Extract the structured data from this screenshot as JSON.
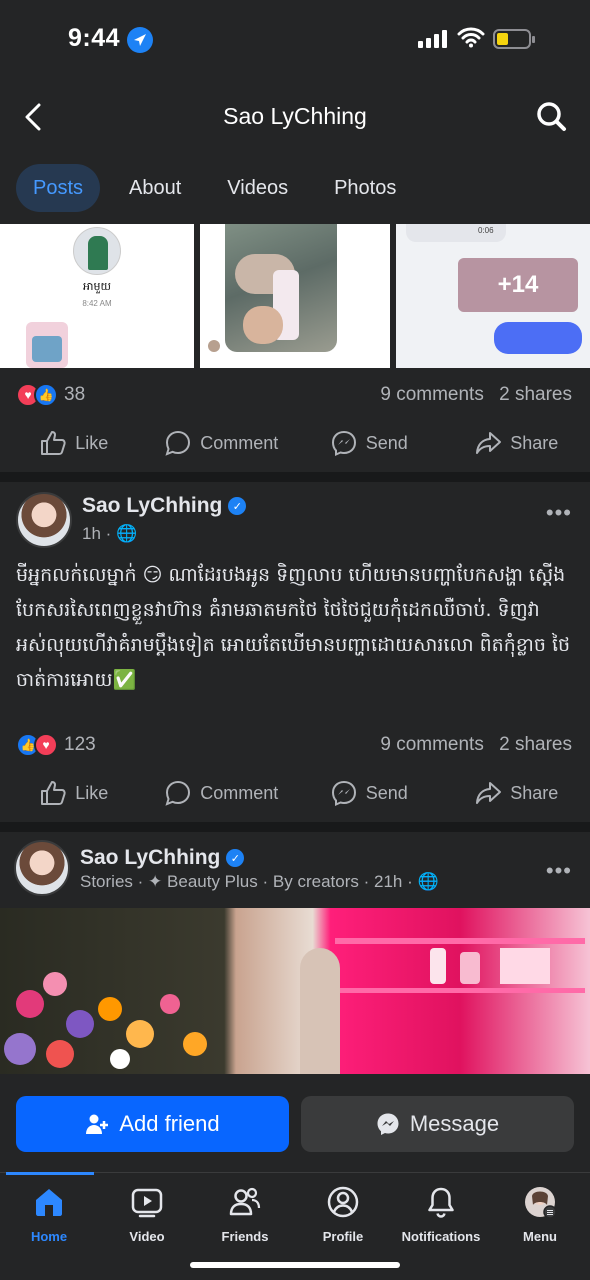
{
  "status_bar": {
    "time": "9:44"
  },
  "topbar": {
    "title": "Sao LyChhing",
    "back_icon": "chevron-left-icon",
    "search_icon": "search-icon"
  },
  "tabs": [
    {
      "label": "Posts",
      "active": true
    },
    {
      "label": "About",
      "active": false
    },
    {
      "label": "Videos",
      "active": false
    },
    {
      "label": "Photos",
      "active": false
    }
  ],
  "thumbs": {
    "t1_caption": "អាមួយ",
    "t1_time": "8:42 AM",
    "t3_more": "+14",
    "t3_time": "0:06"
  },
  "post1": {
    "reaction_count": "38",
    "comments": "9 comments",
    "shares": "2 shares"
  },
  "actions": {
    "like": "Like",
    "comment": "Comment",
    "send": "Send",
    "share": "Share"
  },
  "post2": {
    "author": "Sao LyChhing",
    "time": "1h",
    "text": "មីអ្នកលក់លេម្នាក់ 😏 ណាដែរបងអូន ទិញលាប ហើយមានបញ្ហាបែកសង្ហា ស្តើងបែកសរសៃពេញខ្លួនវាហ៊ាន គំរាមឆាតមកថៃ ថៃថៃជួយកុំដេកឈឺចាប់. ទិញវាអស់លុយហើវាគំរាមប្ដឹងទៀត អោយតែឃើមានបញ្ហាដោយសារលោ ពិតកុំខ្លាច ថៃចាត់ការអោយ✅",
    "reaction_count": "123",
    "comments": "9 comments",
    "shares": "2 shares"
  },
  "post3": {
    "author": "Sao LyChhing",
    "meta_stories": "Stories",
    "meta_effect": "Beauty Plus",
    "meta_by": "By creators",
    "meta_time": "21h"
  },
  "cta": {
    "add_friend": "Add friend",
    "message": "Message"
  },
  "nav": [
    {
      "label": "Home",
      "icon": "home-icon",
      "active": true
    },
    {
      "label": "Video",
      "icon": "video-icon",
      "active": false
    },
    {
      "label": "Friends",
      "icon": "friends-icon",
      "active": false
    },
    {
      "label": "Profile",
      "icon": "profile-icon",
      "active": false
    },
    {
      "label": "Notifications",
      "icon": "bell-icon",
      "active": false
    },
    {
      "label": "Menu",
      "icon": "menu-avatar-icon",
      "active": false
    }
  ],
  "colors": {
    "accent": "#0866ff",
    "active_tab": "#4599ff",
    "background": "#242526",
    "verified": "#1d82f5",
    "story_pink": "#ff1f7a"
  }
}
